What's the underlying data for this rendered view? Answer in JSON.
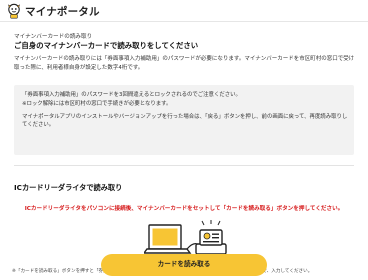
{
  "header": {
    "app_title": "マイナポータル"
  },
  "main": {
    "caption": "マイナンバーカードの読み取り",
    "heading": "ご自身のマイナンバーカードで読み取りをしてください",
    "lead": "マイナンバーカードの読み取りには「券面事項入力補助用」のパスワードが必要になります。マイナンバーカードを市区町村の窓口で受け取った際に、利用者様自身が設定した数字4桁です。",
    "notice": {
      "line1": "「券面事項入力補助用」のパスワードを3回間違えるとロックされるのでご注意ください。",
      "line2": "※ロック解除には市区町村の窓口で手続きが必要となります。",
      "line3": "マイナポータルアプリのインストールやバージョンアップを行った場合は、「戻る」ボタンを押し、前の画面に戻って、再度読み取りしてください。"
    }
  },
  "reader_section": {
    "title": "ICカードリーダライタで読み取り",
    "instruction": "ICカードリーダライタをパソコンに接続後、マイナンバーカードをセットして「カードを読み取る」ボタンを押してください。",
    "footnote": "※「カードを読み取る」ボタンを押すと「券面事項入力補助用」のパスワード（数字4桁）の入力画面が立ち上がりますので、入力してください。",
    "read_button_label": "カードを読み取る"
  },
  "colors": {
    "accent": "#f7c534",
    "warning": "#d6191a",
    "notice_bg": "#f2f2f2"
  }
}
